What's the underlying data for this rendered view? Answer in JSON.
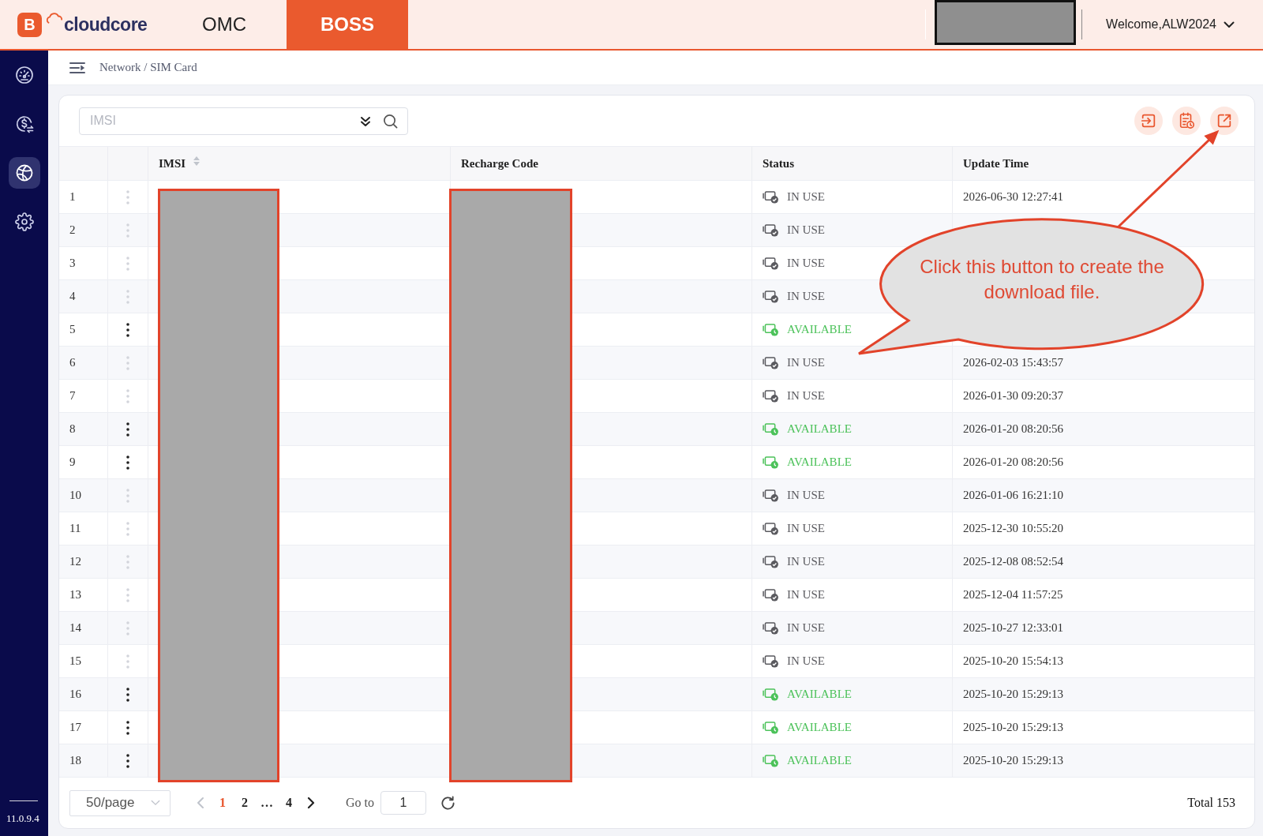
{
  "header": {
    "logo": {
      "mark": "B",
      "name": "cloudcore"
    },
    "tabs": [
      {
        "label": "OMC",
        "selected": false
      },
      {
        "label": "BOSS",
        "selected": true
      }
    ],
    "user_menu": {
      "label": "Welcome,ALW2024"
    }
  },
  "sidebar": {
    "items": [
      {
        "kind": "gauge",
        "selected": false
      },
      {
        "kind": "coin",
        "selected": false
      },
      {
        "kind": "globe",
        "selected": true
      },
      {
        "kind": "gear",
        "selected": false
      }
    ],
    "version": "11.0.9.4"
  },
  "breadcrumb": "Network / SIM Card",
  "search": {
    "placeholder": "IMSI"
  },
  "table": {
    "columns": [
      {
        "label": "IMSI",
        "sortable": true
      },
      {
        "label": "Recharge Code"
      },
      {
        "label": "Status"
      },
      {
        "label": "Update Time"
      }
    ],
    "rows": [
      {
        "number": "1",
        "menu_enabled": false,
        "status": {
          "text": "IN USE",
          "kind": "in_use"
        },
        "update_time": "2026-06-30 12:27:41"
      },
      {
        "number": "2",
        "menu_enabled": false,
        "status": {
          "text": "IN USE",
          "kind": "in_use"
        }
      },
      {
        "number": "3",
        "menu_enabled": false,
        "status": {
          "text": "IN USE",
          "kind": "in_use"
        }
      },
      {
        "number": "4",
        "menu_enabled": false,
        "status": {
          "text": "IN USE",
          "kind": "in_use"
        }
      },
      {
        "number": "5",
        "menu_enabled": true,
        "status": {
          "text": "AVAILABLE",
          "kind": "available"
        }
      },
      {
        "number": "6",
        "menu_enabled": false,
        "status": {
          "text": "IN USE",
          "kind": "in_use"
        },
        "update_time": "2026-02-03 15:43:57"
      },
      {
        "number": "7",
        "menu_enabled": false,
        "status": {
          "text": "IN USE",
          "kind": "in_use"
        },
        "update_time": "2026-01-30 09:20:37"
      },
      {
        "number": "8",
        "menu_enabled": true,
        "status": {
          "text": "AVAILABLE",
          "kind": "available"
        },
        "update_time": "2026-01-20 08:20:56"
      },
      {
        "number": "9",
        "menu_enabled": true,
        "status": {
          "text": "AVAILABLE",
          "kind": "available"
        },
        "update_time": "2026-01-20 08:20:56"
      },
      {
        "number": "10",
        "menu_enabled": false,
        "status": {
          "text": "IN USE",
          "kind": "in_use"
        },
        "update_time": "2026-01-06 16:21:10"
      },
      {
        "number": "11",
        "menu_enabled": false,
        "status": {
          "text": "IN USE",
          "kind": "in_use"
        },
        "update_time": "2025-12-30 10:55:20"
      },
      {
        "number": "12",
        "menu_enabled": false,
        "status": {
          "text": "IN USE",
          "kind": "in_use"
        },
        "update_time": "2025-12-08 08:52:54"
      },
      {
        "number": "13",
        "menu_enabled": false,
        "status": {
          "text": "IN USE",
          "kind": "in_use"
        },
        "update_time": "2025-12-04 11:57:25"
      },
      {
        "number": "14",
        "menu_enabled": false,
        "status": {
          "text": "IN USE",
          "kind": "in_use"
        },
        "update_time": "2025-10-27 12:33:01"
      },
      {
        "number": "15",
        "menu_enabled": false,
        "status": {
          "text": "IN USE",
          "kind": "in_use"
        },
        "update_time": "2025-10-20 15:54:13"
      },
      {
        "number": "16",
        "menu_enabled": true,
        "status": {
          "text": "AVAILABLE",
          "kind": "available"
        },
        "update_time": "2025-10-20 15:29:13"
      },
      {
        "number": "17",
        "menu_enabled": true,
        "status": {
          "text": "AVAILABLE",
          "kind": "available"
        },
        "update_time": "2025-10-20 15:29:13"
      },
      {
        "number": "18",
        "menu_enabled": true,
        "status": {
          "text": "AVAILABLE",
          "kind": "available"
        },
        "update_time": "2025-10-20 15:29:13"
      }
    ]
  },
  "pagination": {
    "page_size": "50/page",
    "prev_disabled": true,
    "pages": [
      {
        "label": "1",
        "selected": true
      },
      {
        "label": "2",
        "selected": false
      },
      {
        "label": "…",
        "selected": false
      },
      {
        "label": "4",
        "selected": false
      }
    ],
    "next_disabled": false,
    "goto_label": "Go to",
    "goto_value": "1",
    "total": "Total 153"
  },
  "callout": {
    "text": "Click this button to create the download file."
  }
}
